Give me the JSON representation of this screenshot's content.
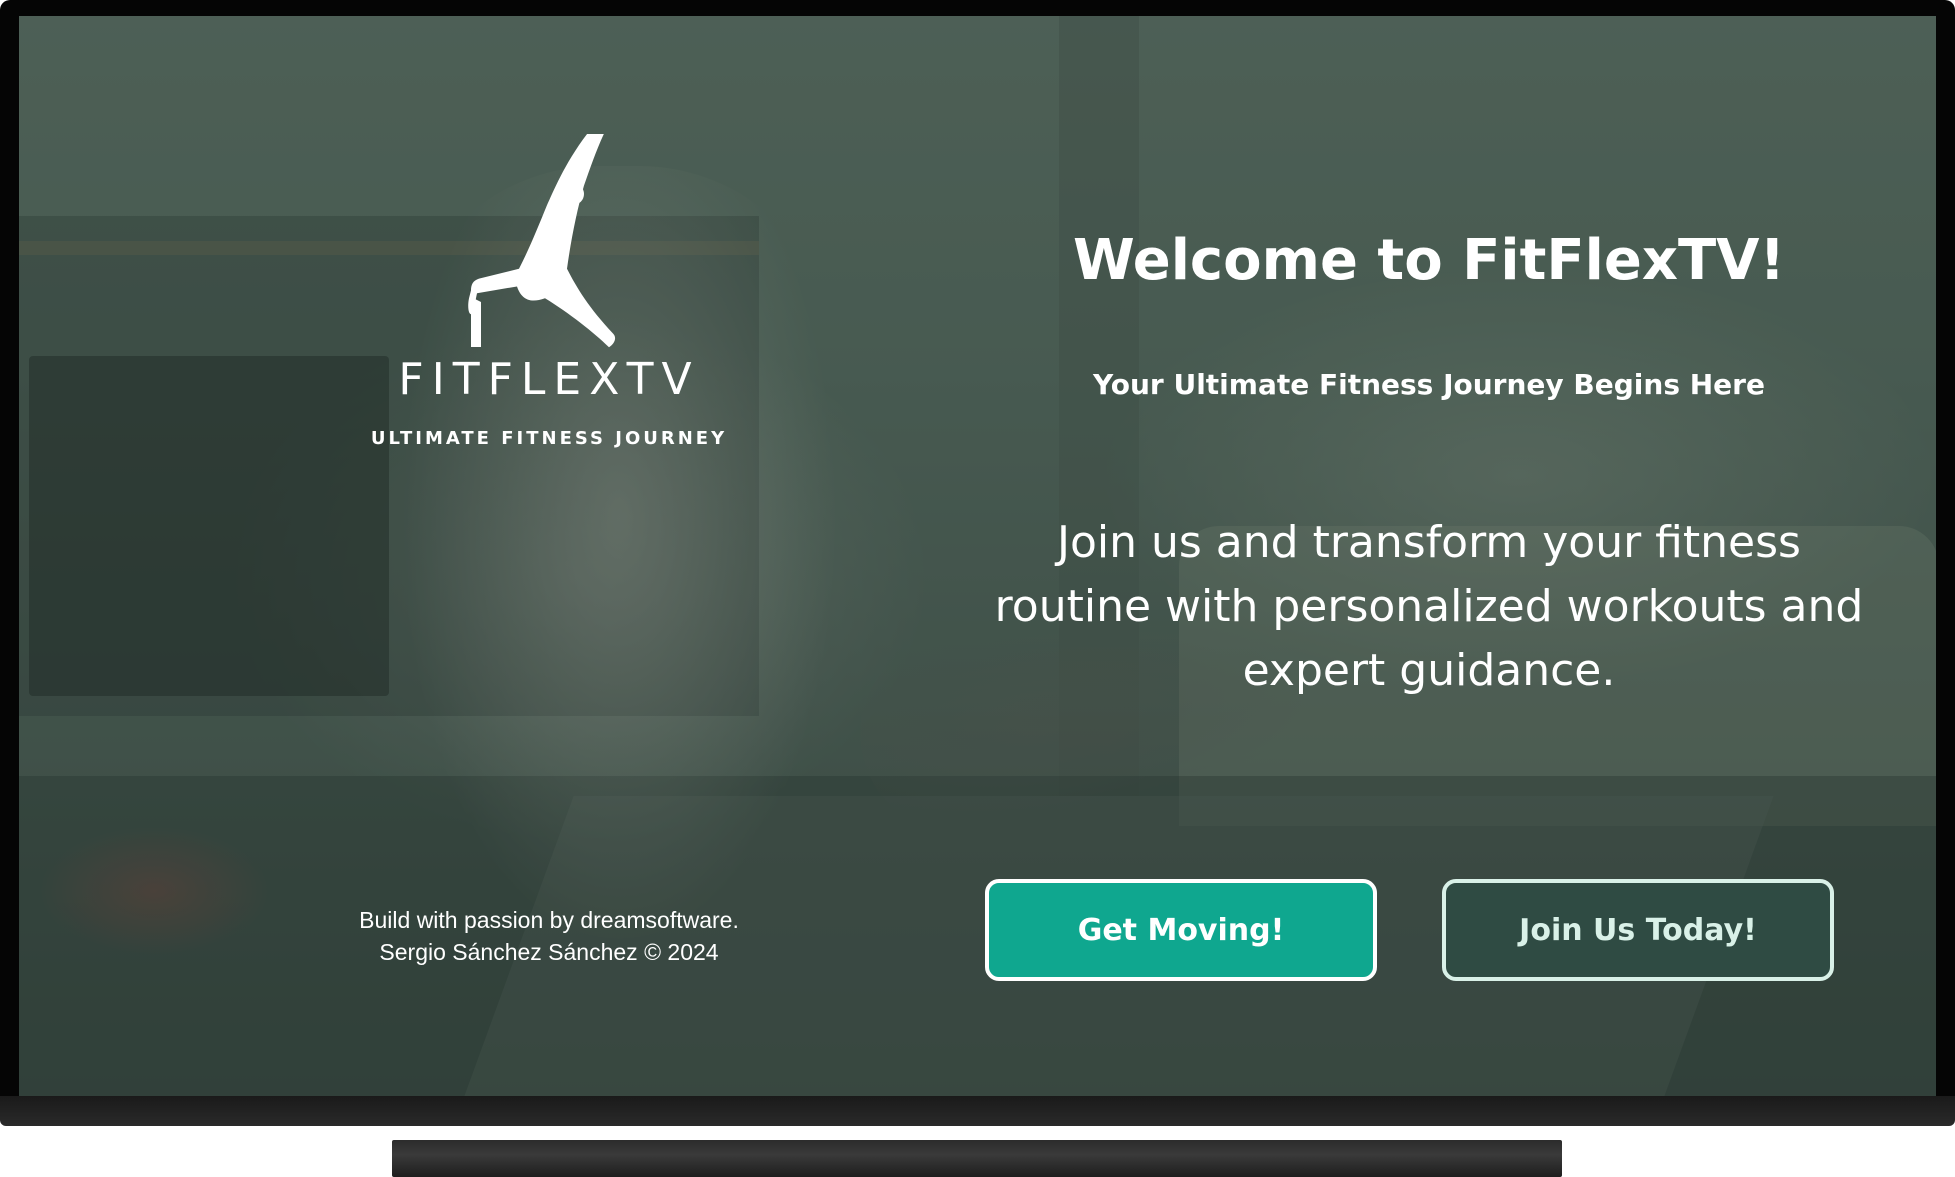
{
  "brand": {
    "name": "FITFLEXTV",
    "tagline": "ULTIMATE FITNESS JOURNEY"
  },
  "welcome": {
    "title": "Welcome to FitFlexTV!",
    "subtitle": "Your Ultimate Fitness Journey Begins Here",
    "body": "Join us and transform your fitness routine with personalized workouts and expert guidance."
  },
  "buttons": {
    "primary_label": "Get Moving!",
    "secondary_label": "Join Us Today!"
  },
  "footer": {
    "line1": "Build with passion by dreamsoftware.",
    "line2": "Sergio Sánchez Sánchez © 2024"
  },
  "colors": {
    "primary_button": "#0fa78f",
    "secondary_button": "#2f4b43",
    "secondary_border": "#d9f1e8",
    "overlay": "#2d463c"
  },
  "icons": {
    "logo": "yoga-pose-icon"
  }
}
